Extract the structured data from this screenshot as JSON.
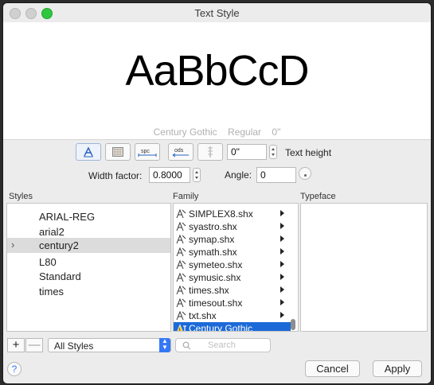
{
  "window": {
    "title": "Text Style"
  },
  "preview": {
    "sample_text": "AaBbCcD",
    "font_name": "Century Gothic",
    "font_style": "Regular",
    "height_value": "0\""
  },
  "toolbar": {
    "buttons": [
      {
        "icon": "annotative-a-icon"
      },
      {
        "icon": "background-mask-icon"
      },
      {
        "icon": "spacing-icon",
        "label": "spc"
      },
      {
        "icon": "oblique-icon",
        "label": "ods"
      },
      {
        "icon": "vertical-text-icon"
      }
    ],
    "text_height_value": "0\"",
    "text_height_label": "Text height",
    "width_factor_label": "Width factor:",
    "width_factor_value": "0.8000",
    "angle_label": "Angle:",
    "angle_value": "0"
  },
  "styles": {
    "header": "Styles",
    "items": [
      "ARIAL-REG",
      "arial2",
      "century2",
      "L80",
      "Standard",
      "times"
    ],
    "selected": "century2"
  },
  "family": {
    "header": "Family",
    "items": [
      "SIMPLEX8.shx",
      "syastro.shx",
      "symap.shx",
      "symath.shx",
      "symeteo.shx",
      "symusic.shx",
      "times.shx",
      "timesout.shx",
      "txt.shx",
      "Century Gothic"
    ],
    "selected": "Century Gothic"
  },
  "typeface": {
    "header": "Typeface"
  },
  "bottom": {
    "add_label": "+",
    "remove_label": "—",
    "filter_value": "All Styles",
    "search_placeholder": "Search",
    "help_label": "?",
    "cancel_label": "Cancel",
    "apply_label": "Apply"
  },
  "colors": {
    "accent": "#1b6ad8",
    "maximize": "#2ec73d"
  }
}
